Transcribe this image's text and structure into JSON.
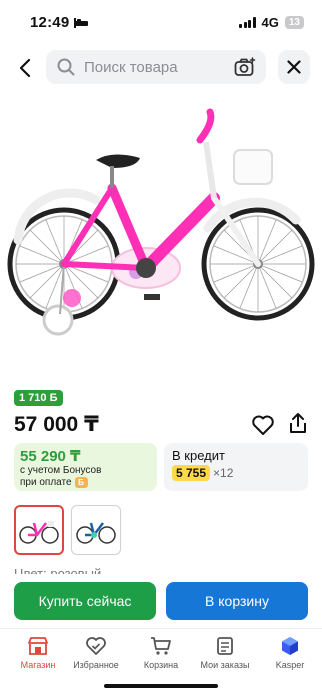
{
  "status": {
    "time": "12:49",
    "network": "4G",
    "battery": "13"
  },
  "search": {
    "placeholder": "Поиск товара"
  },
  "product": {
    "bonus_badge": "1 710 Б",
    "price": "57 000 ₸",
    "bonus_card": {
      "amount": "55 290 ₸",
      "line1": "с учетом Бонусов",
      "line2": "при оплате"
    },
    "credit_card": {
      "title": "В кредит",
      "amount": "5 755",
      "multiplier": "×12"
    },
    "color_label": "Цвет: розовый"
  },
  "actions": {
    "buy_now": "Купить сейчас",
    "add_to_cart": "В корзину"
  },
  "tabbar": {
    "items": [
      {
        "label": "Магазин",
        "icon": "shop-icon",
        "active": true
      },
      {
        "label": "Избранное",
        "icon": "heart-icon",
        "active": false
      },
      {
        "label": "Корзина",
        "icon": "cart-icon",
        "active": false
      },
      {
        "label": "Мои заказы",
        "icon": "orders-icon",
        "active": false
      },
      {
        "label": "Kasper",
        "icon": "kasper-cube-icon",
        "active": false
      }
    ]
  },
  "colors": {
    "accent_red": "#e0463f",
    "buy_green": "#1f9e48",
    "cart_blue": "#1677d6",
    "bonus_green": "#2e9e3a",
    "credit_yellow": "#ffd84d"
  }
}
